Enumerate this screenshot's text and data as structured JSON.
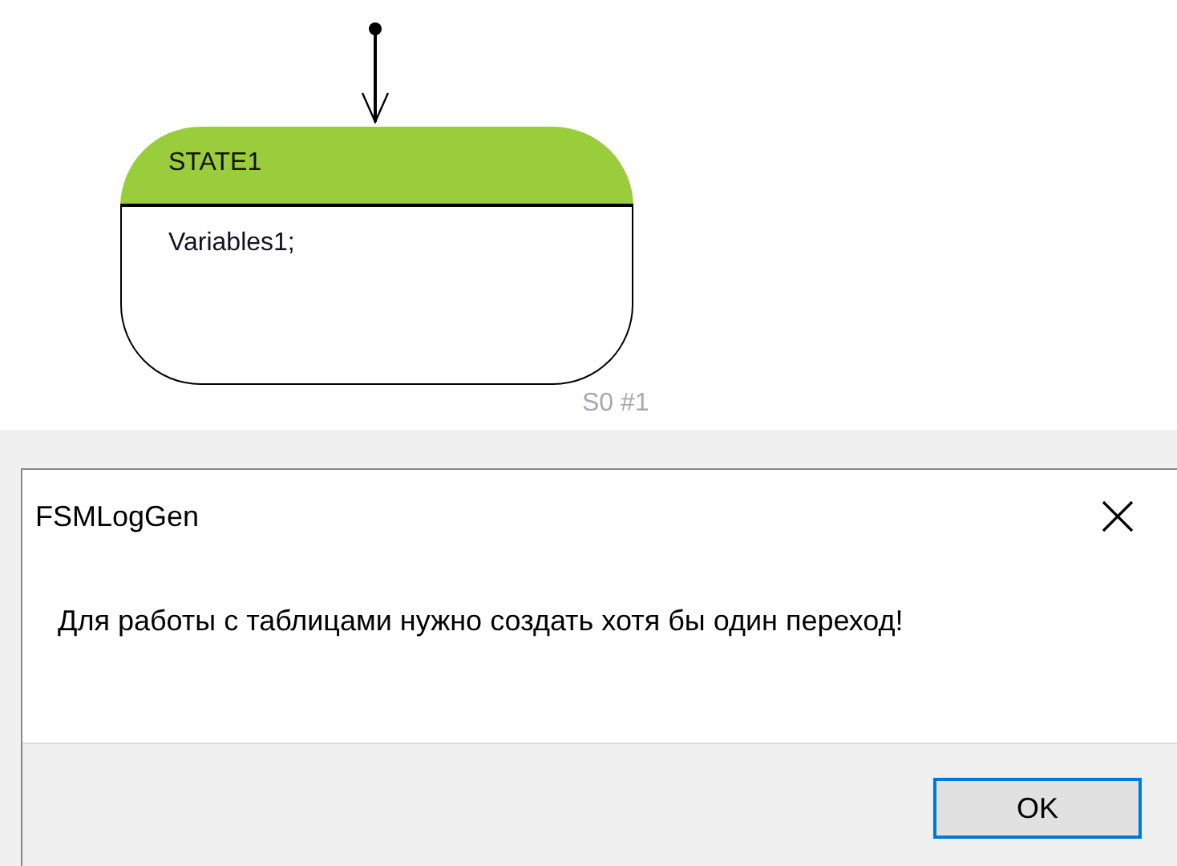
{
  "diagram": {
    "state": {
      "name": "STATE1",
      "variables": "Variables1;",
      "id_label": "S0 #1",
      "color": "#9acd3c"
    },
    "initial_transition": true
  },
  "dialog": {
    "title": "FSMLogGen",
    "message": "Для работы с таблицами нужно создать хотя бы один переход!",
    "buttons": [
      {
        "label": "OK",
        "selected": true
      }
    ]
  }
}
